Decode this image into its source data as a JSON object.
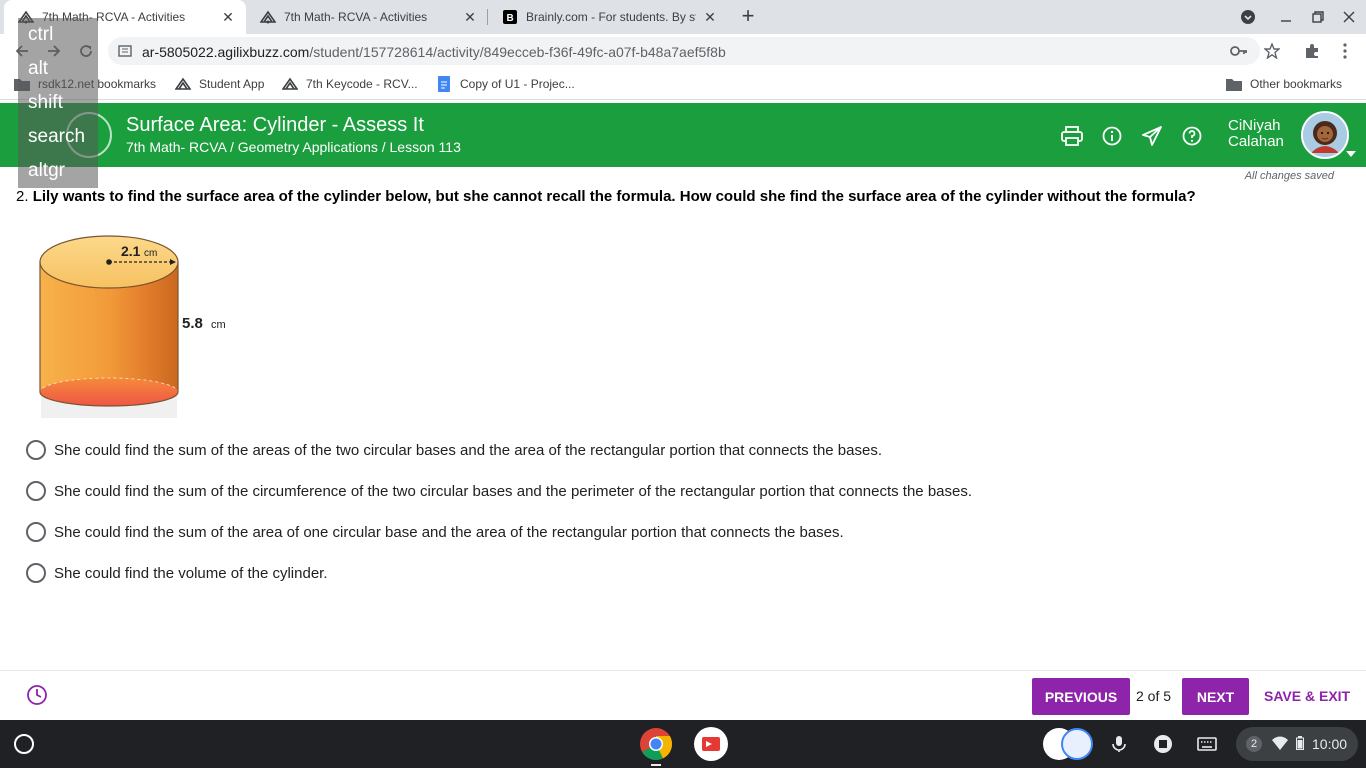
{
  "browser": {
    "tabs": [
      {
        "title": "7th Math- RCVA - Activities",
        "favicon": "agilix-icon",
        "active": true
      },
      {
        "title": "7th Math- RCVA - Activities",
        "favicon": "agilix-icon",
        "active": false
      },
      {
        "title": "Brainly.com - For students. By st",
        "favicon": "brainly-icon",
        "active": false
      }
    ],
    "url_host": "ar-5805022.agilixbuzz.com",
    "url_path": "/student/157728614/activity/849ecceb-f36f-49fc-a07f-b48a7aef5f8b",
    "bookmarks": [
      {
        "label": "rsdk12.net bookmarks",
        "icon": "folder-icon"
      },
      {
        "label": "Student App",
        "icon": "agilix-icon"
      },
      {
        "label": "7th Keycode - RCV...",
        "icon": "agilix-icon"
      },
      {
        "label": "Copy of U1 - Projec...",
        "icon": "docs-icon"
      }
    ],
    "other_bookmarks": "Other bookmarks"
  },
  "keyboard_overlay": [
    "ctrl",
    "alt",
    "shift",
    "search",
    "altgr"
  ],
  "header": {
    "title": "Surface Area: Cylinder - Assess It",
    "breadcrumb": "7th Math- RCVA / Geometry Applications / Lesson 113",
    "user_first": "CiNiyah",
    "user_last": "Calahan",
    "icons": [
      "print-icon",
      "info-icon",
      "send-icon",
      "help-icon"
    ]
  },
  "status_saved": "All changes saved",
  "question": {
    "number": "2.",
    "text": "Lily wants to find the surface area of the cylinder below, but she cannot recall the formula. How could she find the surface area of the cylinder without the formula?",
    "figure": {
      "radius_label": "2.1",
      "height_label": "5.8",
      "unit": "cm"
    },
    "options": [
      "She could find the sum of the areas of the two circular bases and the area of the rectangular portion that connects the bases.",
      "She could find the sum of the circumference of the two circular bases and the perimeter of the rectangular portion that connects the bases.",
      "She could find the sum of the area of one circular base and the area of the rectangular portion that connects the bases.",
      "She could find the volume of the cylinder."
    ]
  },
  "footer": {
    "previous": "PREVIOUS",
    "page": "2 of 5",
    "next": "NEXT",
    "save_exit": "SAVE & EXIT"
  },
  "shelf": {
    "notifications": "2",
    "time": "10:00"
  },
  "colors": {
    "header_green": "#1b9e3e",
    "button_purple": "#8e24aa"
  }
}
